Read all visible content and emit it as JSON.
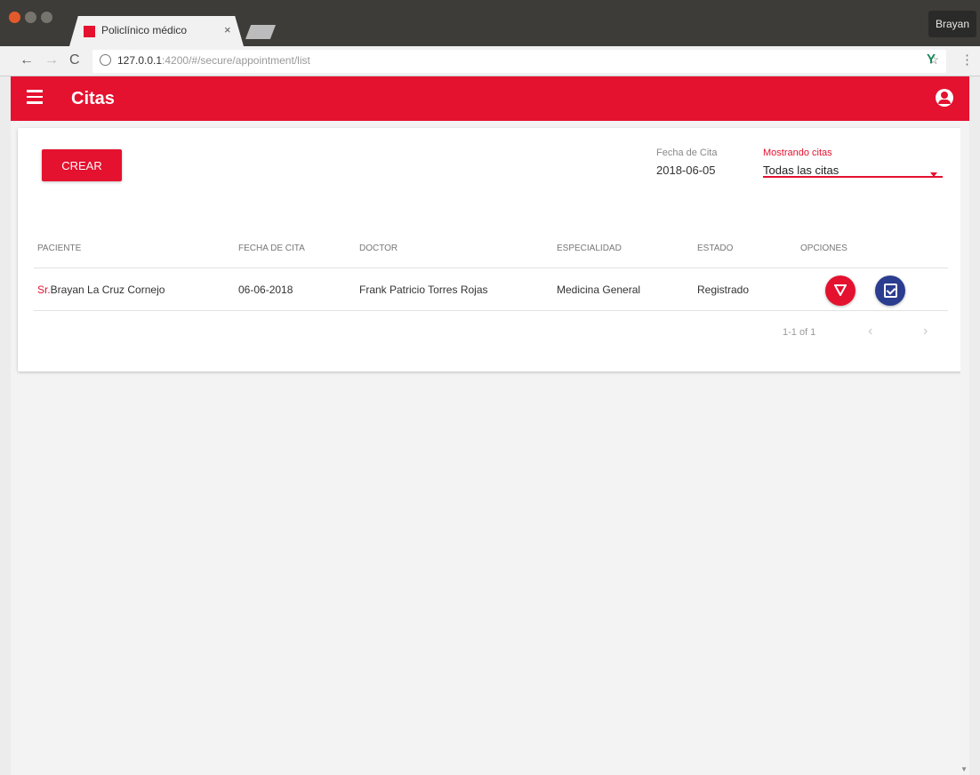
{
  "browser": {
    "tab_title": "Policlínico médico",
    "tab_close": "×",
    "profile_name": "Brayan",
    "url_host": "127.0.0.1",
    "url_path": ":4200/#/secure/appointment/list",
    "nav": {
      "back": "←",
      "forward": "→",
      "reload": "C"
    },
    "icons": {
      "star": "☆",
      "extension": "Y",
      "menu": "⋮"
    }
  },
  "appbar": {
    "title": "Citas",
    "accent_color": "#e4112f"
  },
  "toolbar": {
    "create_label": "CREAR",
    "date_label": "Fecha de Cita",
    "date_value": "2018-06-05",
    "select_label": "Mostrando citas",
    "select_value": "Todas las citas"
  },
  "table": {
    "headers": [
      "PACIENTE",
      "FECHA DE CITA",
      "DOCTOR",
      "ESPECIALIDAD",
      "ESTADO",
      "OPCIONES"
    ],
    "rows": [
      {
        "prefix": "Sr.",
        "patient": "Brayan La Cruz Cornejo",
        "date": "06-06-2018",
        "doctor": "Frank Patricio Torres Rojas",
        "specialty": "Medicina General",
        "status": "Registrado"
      }
    ]
  },
  "pagination": {
    "info": "1-1 of 1",
    "prev": "‹",
    "next": "›"
  },
  "colors": {
    "primary": "#e4112f",
    "secondary": "#2b3d8f"
  }
}
